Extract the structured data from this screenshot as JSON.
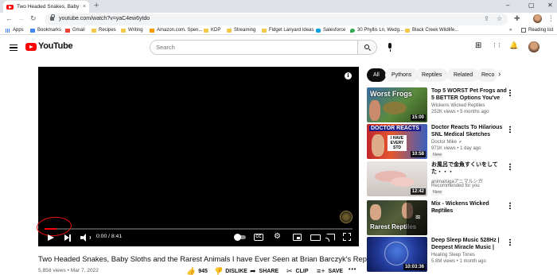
{
  "browser": {
    "tab_title": "Two Headed Snakes, Baby Sloths",
    "tab_close": "×",
    "new_tab": "+",
    "url": "youtube.com/watch?v=yaC4ew6ytdo",
    "win_min": "–",
    "win_max": "▢",
    "win_close": "✕",
    "back": "←",
    "forward": "→",
    "reload": "↻",
    "share_icon": "⇪",
    "star_icon": "☆",
    "puzzle_icon": "✚",
    "menu_icon": "⋮"
  },
  "bookmarks": {
    "items": [
      "Apps",
      "Bookmarks",
      "Gmail",
      "Recipes",
      "Writing",
      "Amazon.com. Spen...",
      "KDP",
      "Streaming",
      "Fidget Lanyard Ideas",
      "Salesforce",
      "30 Phyllis Ln, Wedg...",
      "Black Creek Wildlife..."
    ],
    "more": "»",
    "reading_list": "Reading list"
  },
  "header": {
    "logo_text": "YouTube",
    "search_placeholder": "Search",
    "create_icon": "⊞",
    "apps_icon": "⋮⋮",
    "bell_icon": "🔔"
  },
  "player": {
    "info_glyph": "i",
    "progress_fraction": 0.04,
    "time": "0 / 8:41",
    "time_display": "0:00 / 8:41",
    "cc_label": "CC",
    "settings_glyph": "⚙"
  },
  "video": {
    "title": "Two Headed Snakes, Baby Sloths and the Rarest Animals I have Ever Seen at Brian Barczyk's Reptarium",
    "meta": "5,858 views • Mar 7, 2022",
    "like_count": "945",
    "dislike": "DISLIKE",
    "share": "SHARE",
    "clip": "CLIP",
    "save": "SAVE",
    "more": "•••"
  },
  "chips": [
    "All",
    "Pythons",
    "Reptiles",
    "Related",
    "Reco"
  ],
  "recommendations": [
    {
      "title": "Top 5 WORST Pet Frogs and 5 BETTER Options You've Never...",
      "channel": "Wickens Wicked Reptiles",
      "verified": false,
      "stats": "252K views • 5 months ago",
      "duration": "15:00",
      "badge": "",
      "thumb_text": "Worst Frogs"
    },
    {
      "title": "Doctor Reacts To Hilarious SNL Medical Sketches",
      "channel": "Doctor Mike",
      "verified": true,
      "stats": "971K views • 1 day ago",
      "duration": "10:58",
      "badge": "New",
      "thumb_text": "DOCTOR REACTS",
      "thumb_sign": "I HAVE EVERY STD"
    },
    {
      "title": "お風呂で金魚すくいをしてた・・・",
      "channel": "animalsiga",
      "verified": false,
      "stats": "Recommended for you",
      "duration": "12:42",
      "badge": "New",
      "channel_extra": "アニマルシガ"
    },
    {
      "title": "Mix - Wickens Wicked Reptiles",
      "channel": "YouTube",
      "verified": false,
      "stats": "",
      "duration": "",
      "badge": "",
      "thumb_text": "Rarest Reptiles"
    },
    {
      "title": "Deep Sleep Music 528Hz | Deepest Miracle Music | Deep...",
      "channel": "Healing Sleep Tones",
      "verified": false,
      "stats": "5.8M views • 1 month ago",
      "duration": "10:03:36",
      "badge": ""
    }
  ]
}
